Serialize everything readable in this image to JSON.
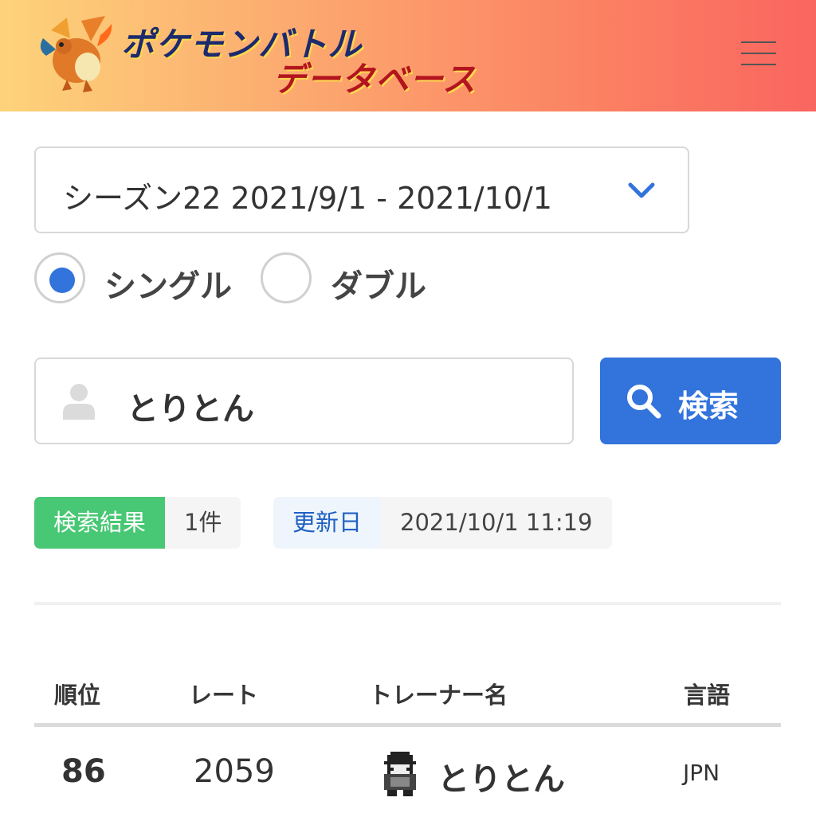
{
  "header": {
    "logo_line1": "ポケモンバトル",
    "logo_line2": "データベース",
    "mascot_icon": "charizard-mascot-icon",
    "menu_icon": "hamburger-menu-icon"
  },
  "filters": {
    "season_label": "シーズン22  2021/9/1 - 2021/10/1",
    "format_options": [
      {
        "label": "シングル",
        "selected": true
      },
      {
        "label": "ダブル",
        "selected": false
      }
    ]
  },
  "search": {
    "value": "とりとん",
    "button_label": "検索",
    "user_icon": "user-icon",
    "button_icon": "search-icon"
  },
  "result_tags": {
    "result_label": "検索結果",
    "result_count": "1件",
    "updated_label": "更新日",
    "updated_value": "2021/10/1 11:19"
  },
  "table": {
    "headers": [
      "順位",
      "レート",
      "トレーナー名",
      "言語"
    ],
    "rows": [
      {
        "rank": "86",
        "rate": "2059",
        "name": "とりとん",
        "lang": "JPN",
        "avatar_icon": "trainer-pixel-avatar-icon"
      }
    ]
  },
  "colors": {
    "primary": "#3273dc",
    "success": "#48c774",
    "header_gradient_start": "#fdd37a",
    "header_gradient_end": "#fa6560"
  }
}
